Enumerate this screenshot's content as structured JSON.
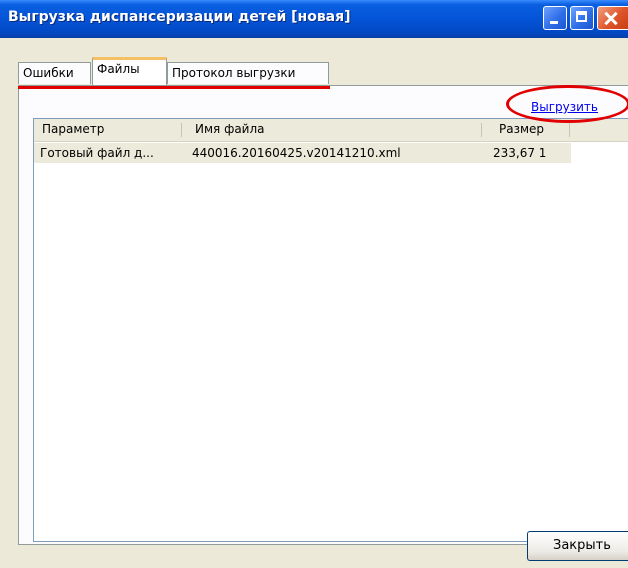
{
  "window": {
    "title": "Выгрузка диспансеризации детей [новая]"
  },
  "tabs": [
    {
      "label": "Ошибки",
      "active": false
    },
    {
      "label": "Файлы",
      "active": true
    },
    {
      "label": "Протокол выгрузки",
      "active": false
    }
  ],
  "actions": {
    "export_link": "Выгрузить"
  },
  "table": {
    "columns": [
      "Параметр",
      "Имя файла",
      "Размер"
    ],
    "rows": [
      [
        "Готовый файл д...",
        "440016.20160425.v20141210.xml",
        "233,67 1"
      ]
    ]
  },
  "footer": {
    "close_label": "Закрыть"
  },
  "colors": {
    "titlebar": "#0454d8",
    "annotation": "#e00000",
    "link": "#0000ee",
    "selected_row": "#ecebdb"
  },
  "icons": [
    "minimize-icon",
    "maximize-icon",
    "close-icon"
  ]
}
